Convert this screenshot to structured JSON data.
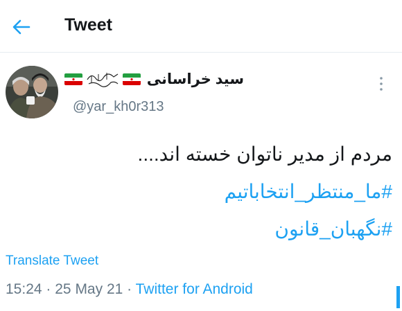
{
  "header": {
    "title": "Tweet",
    "back_icon": "arrow-left-icon"
  },
  "author": {
    "display_name": "سید خراسانی",
    "bismillah": "بسم الله الرحمن الرحیم",
    "handle": "@yar_kh0r313",
    "avatar_icon": "profile-photo"
  },
  "tweet": {
    "text": "مردم از مدیر ناتوان خسته اند....",
    "hashtags": [
      "#ما_منتظر_انتخاباتیم",
      "#نگهبان_قانون"
    ]
  },
  "actions": {
    "translate_label": "Translate Tweet",
    "more_icon": "more-vertical-icon"
  },
  "meta": {
    "time": "15:24",
    "separator": "·",
    "date": "25 May 21",
    "source": "Twitter for Android"
  },
  "colors": {
    "accent": "#1da1f2",
    "secondary_text": "#657786",
    "primary_text": "#14171a"
  }
}
